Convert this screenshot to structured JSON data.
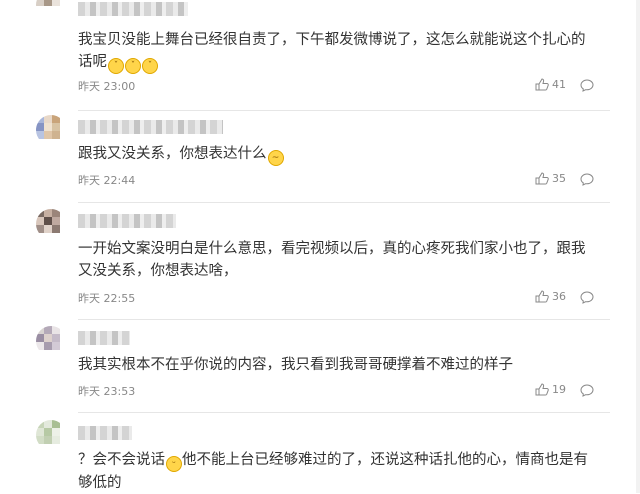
{
  "colors": {
    "text": "#333333",
    "meta": "#888888",
    "divider": "#e6e6e6",
    "emoji": "#ffd54a"
  },
  "comments": [
    {
      "text": "我宝贝没能上舞台已经很自责了，下午都发微博说了，这怎么就能说这个扎心的话呢",
      "emojis": [
        "crying-face-icon",
        "crying-face-icon",
        "crying-face-icon"
      ],
      "time": "昨天 23:00",
      "likes": "41"
    },
    {
      "text": "跟我又没关系，你想表达什么",
      "emojis": [
        "confused-face-icon"
      ],
      "time": "昨天 22:44",
      "likes": "35"
    },
    {
      "text": "一开始文案没明白是什么意思，看完视频以后，真的心疼死我们家小也了，跟我又没关系，你想表达啥，",
      "time": "昨天 22:55",
      "likes": "36"
    },
    {
      "text": "我其实根本不在乎你说的内容，我只看到我哥哥硬撑着不难过的样子",
      "time": "昨天 23:53",
      "likes": "19"
    },
    {
      "text_before_emoji": "？会不会说话",
      "emojis": [
        "smile-face-icon"
      ],
      "text_after_emoji": "他不能上台已经够难过的了，还说这种话扎他的心，情商也是有够低的"
    }
  ]
}
